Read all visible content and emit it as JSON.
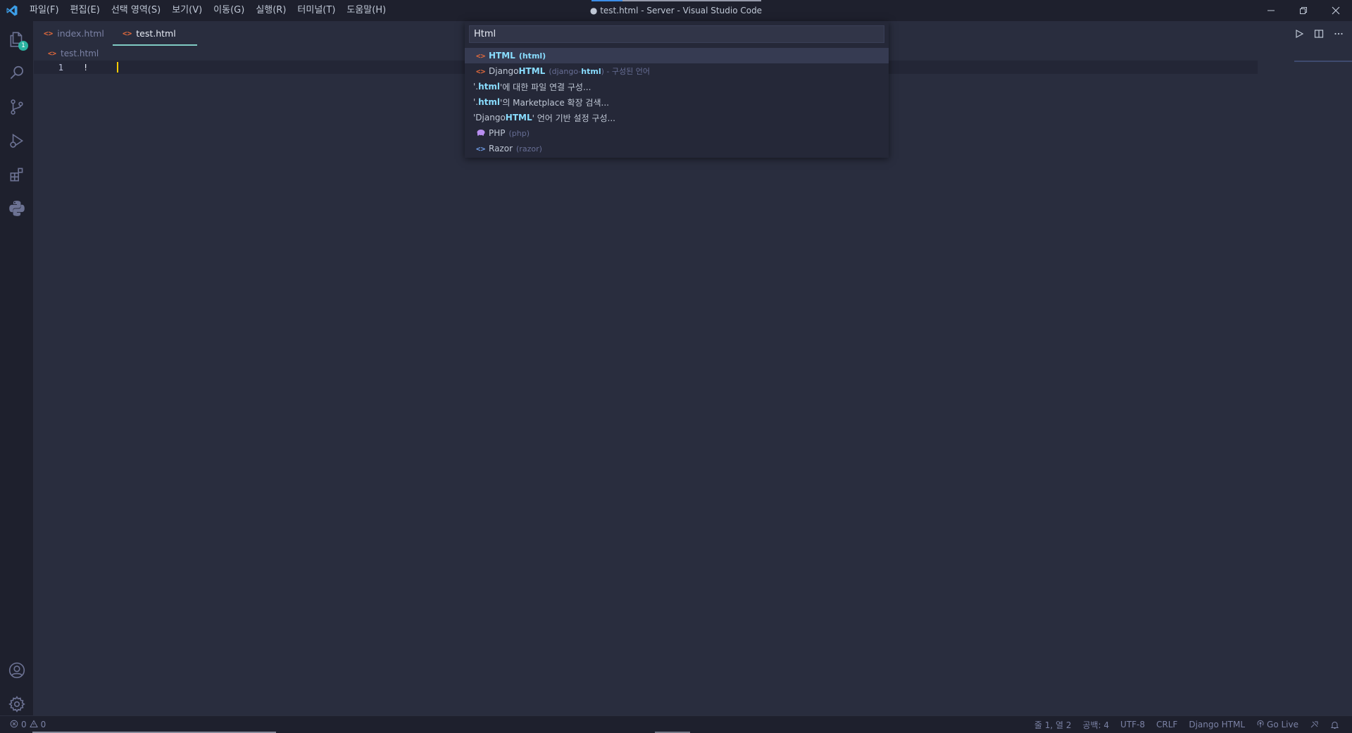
{
  "window": {
    "title": "● test.html - Server - Visual Studio Code"
  },
  "menu": [
    "파일(F)",
    "편집(E)",
    "선택 영역(S)",
    "보기(V)",
    "이동(G)",
    "실행(R)",
    "터미널(T)",
    "도움말(H)"
  ],
  "activity_bar": {
    "explorer_badge": "1"
  },
  "tabs": [
    {
      "label": "index.html",
      "active": false
    },
    {
      "label": "test.html",
      "active": true,
      "dirty": true
    }
  ],
  "breadcrumb": "test.html",
  "editor": {
    "line_number": "1",
    "line_text": "!"
  },
  "quick_pick": {
    "input_value": "Html",
    "items": [
      {
        "icon": "html-file-icon",
        "label": "HTML",
        "desc": "(html)"
      },
      {
        "icon": "html-file-icon",
        "label_prefix": "Django ",
        "label_hl": "HTML",
        "desc_prefix": "(django-",
        "desc_hl": "html",
        "desc_suffix": ")",
        "suffix": " - 구성된 언어"
      },
      {
        "q1": "'.",
        "hl": "html",
        "rest": "'에 대한 파일 연결 구성..."
      },
      {
        "q1": "'.",
        "hl": "html",
        "rest": "'의 Marketplace 확장 검색..."
      },
      {
        "q1": "'Django ",
        "hl": "HTML",
        "rest": "' 언어 기반 설정 구성..."
      },
      {
        "icon": "php-elephant-icon",
        "label": "PHP",
        "desc": "(php)"
      },
      {
        "icon": "razor-file-icon",
        "label": "Razor",
        "desc": "(razor)"
      }
    ]
  },
  "status_bar": {
    "errors": "0",
    "warnings": "0",
    "position": "줄 1, 열 2",
    "spaces": "공백: 4",
    "encoding": "UTF-8",
    "eol": "CRLF",
    "language": "Django HTML",
    "go_live": "Go Live"
  },
  "colors": {
    "background": "#292d3e",
    "titlebar": "#1e202d",
    "accent": "#80cbc4",
    "html_icon": "#e26a3c",
    "highlight": "#89ddff"
  }
}
